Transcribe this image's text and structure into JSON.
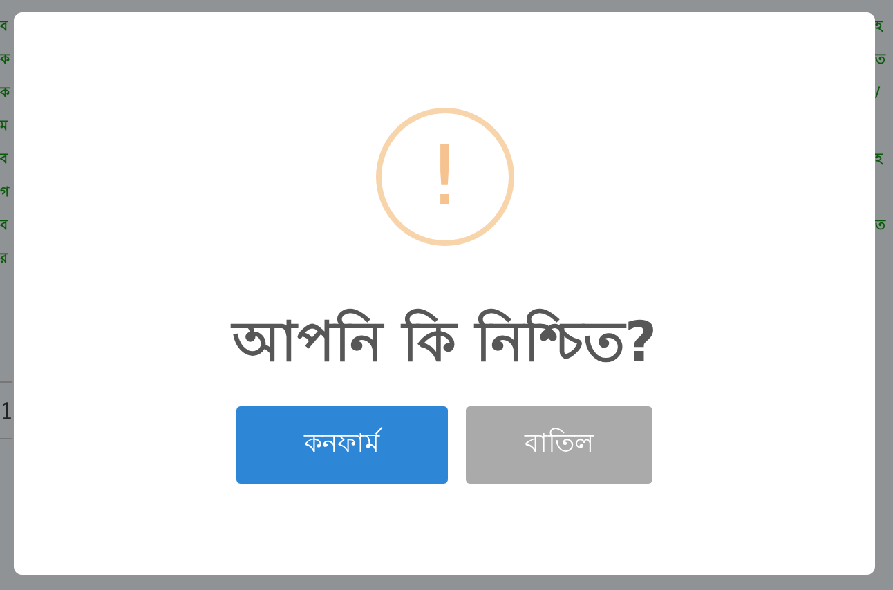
{
  "background": {
    "left_lines": [
      "ব",
      "ক",
      "ক",
      "ম",
      "ব",
      "গ",
      "ব",
      "র"
    ],
    "right_blocks": [
      [
        "হ",
        "ত",
        "/"
      ],
      [
        "হ"
      ],
      [
        "ত"
      ]
    ],
    "table_cell": "1"
  },
  "dialog": {
    "icon": "!",
    "title": "আপনি কি নিশ্চিত?",
    "buttons": [
      {
        "label": "কনফার্ম",
        "kind": "confirm"
      },
      {
        "label": "বাতিল",
        "kind": "cancel"
      }
    ]
  }
}
